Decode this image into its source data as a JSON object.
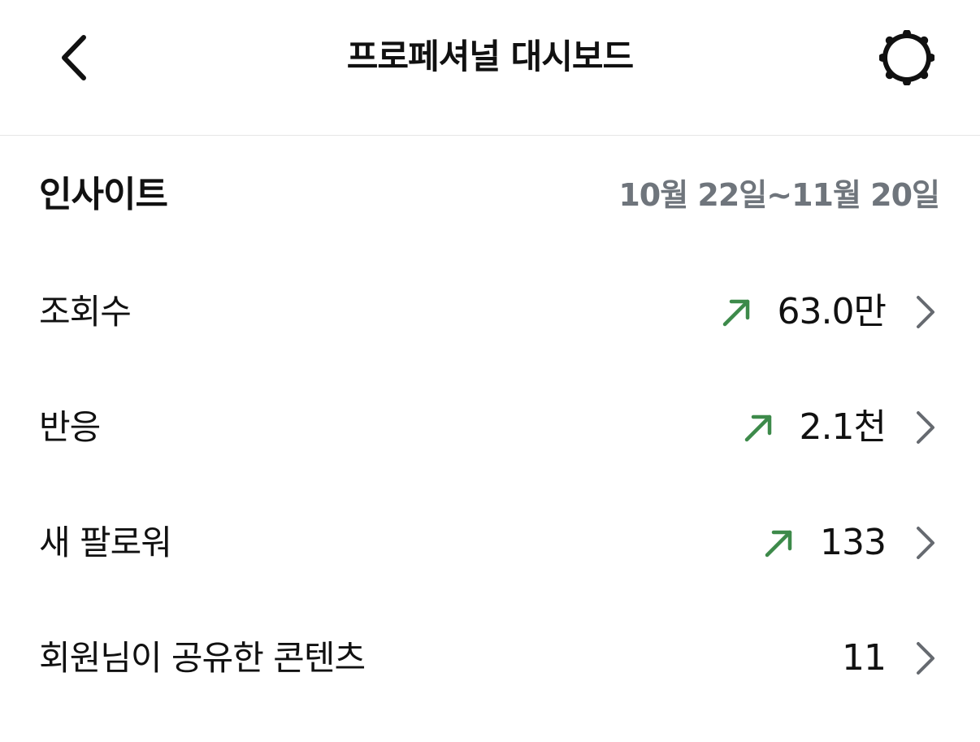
{
  "header": {
    "title": "프로페셔널 대시보드",
    "back_icon": "chevron-left-icon",
    "settings_icon": "gear-icon"
  },
  "insights": {
    "title": "인사이트",
    "date_range": "10월 22일~11월 20일",
    "rows": [
      {
        "label": "조회수",
        "value": "63.0만",
        "trend": "up"
      },
      {
        "label": "반응",
        "value": "2.1천",
        "trend": "up"
      },
      {
        "label": "새 팔로워",
        "value": "133",
        "trend": "up"
      },
      {
        "label": "회원님이 공유한 콘텐츠",
        "value": "11",
        "trend": "none"
      }
    ]
  },
  "colors": {
    "trend_up": "#3d8a4a",
    "date_gray": "#6f757c",
    "chevron_gray": "#666a70",
    "divider": "#e6e6e6"
  }
}
